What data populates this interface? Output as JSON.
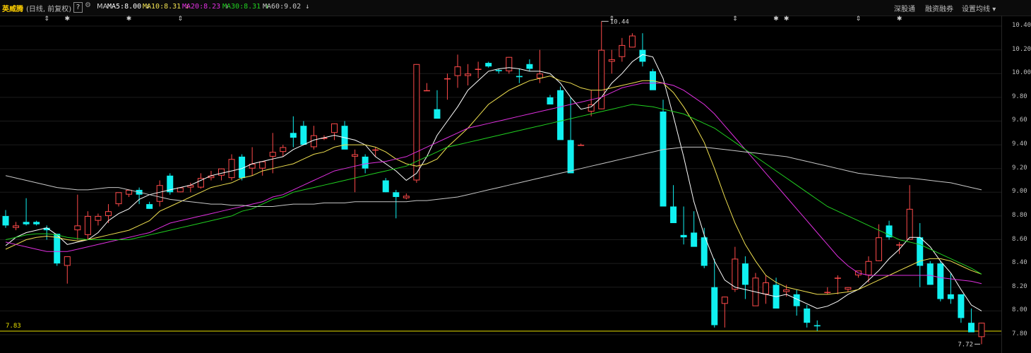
{
  "header": {
    "stock_name": "英威腾",
    "period": "(日线, 前复权)",
    "help": "?",
    "gear_icon": "gear-icon",
    "ma_title": "MA",
    "ma": [
      {
        "label": "MA5:8.00",
        "color": "#ffffff",
        "arrow": "↓"
      },
      {
        "label": "MA10:8.31",
        "color": "#f0e050",
        "arrow": "↓"
      },
      {
        "label": "MA20:8.23",
        "color": "#e030e0",
        "arrow": "↓"
      },
      {
        "label": "MA30:8.31",
        "color": "#20d020",
        "arrow": "↓"
      },
      {
        "label": "MA60:9.02",
        "color": "#c8c8c8",
        "arrow": "↓"
      }
    ],
    "links": [
      "深股通",
      "融资融券",
      "设置均线"
    ]
  },
  "chart_data": {
    "type": "candlestick",
    "ylim": [
      7.7,
      10.5
    ],
    "y_ticks": [
      7.8,
      8.0,
      8.2,
      8.4,
      8.6,
      8.8,
      9.0,
      9.2,
      9.4,
      9.6,
      9.8,
      10.0,
      10.2,
      10.4
    ],
    "y_tick_labels": [
      "7.80",
      "8.00",
      "8.20",
      "8.40",
      "8.60",
      "8.80",
      "9.00",
      "9.20",
      "9.40",
      "9.60",
      "9.80",
      "10.00",
      "10.20",
      "10.40"
    ],
    "max_label": "10.44",
    "min_label": "7.72",
    "reference_line": {
      "value": 7.83,
      "label": "7.83",
      "color": "#e8e000"
    },
    "up_color": "#ff4a4a",
    "down_color": "#10f0f0",
    "event_markers": [
      {
        "index": 4,
        "symbol": "⇕"
      },
      {
        "index": 6,
        "symbol": "✱"
      },
      {
        "index": 12,
        "symbol": "✱"
      },
      {
        "index": 17,
        "symbol": "⇕"
      },
      {
        "index": 59,
        "symbol": "⇕"
      },
      {
        "index": 71,
        "symbol": "⇕"
      },
      {
        "index": 75,
        "symbol": "✱"
      },
      {
        "index": 76,
        "symbol": "✱"
      },
      {
        "index": 83,
        "symbol": "⇕"
      },
      {
        "index": 87,
        "symbol": "✱"
      }
    ],
    "candles": [
      [
        8.8,
        8.85,
        8.7,
        8.72
      ],
      [
        8.7,
        8.75,
        8.68,
        8.72
      ],
      [
        8.75,
        8.95,
        8.72,
        8.73
      ],
      [
        8.75,
        8.76,
        8.72,
        8.73
      ],
      [
        8.7,
        8.72,
        8.6,
        8.68
      ],
      [
        8.65,
        8.65,
        8.38,
        8.4
      ],
      [
        8.38,
        8.46,
        8.23,
        8.46
      ],
      [
        8.68,
        8.98,
        8.6,
        8.72
      ],
      [
        8.64,
        8.84,
        8.6,
        8.8
      ],
      [
        8.76,
        8.82,
        8.72,
        8.8
      ],
      [
        8.8,
        8.9,
        8.74,
        8.84
      ],
      [
        8.9,
        8.98,
        8.88,
        9.0
      ],
      [
        8.98,
        9.0,
        8.96,
        9.02
      ],
      [
        9.02,
        9.04,
        8.9,
        8.98
      ],
      [
        8.9,
        8.92,
        8.86,
        8.86
      ],
      [
        8.92,
        9.1,
        8.88,
        9.06
      ],
      [
        9.14,
        9.16,
        8.98,
        9.0
      ],
      [
        9.0,
        9.04,
        9.0,
        9.04
      ],
      [
        9.04,
        9.08,
        9.0,
        9.06
      ],
      [
        9.04,
        9.16,
        9.03,
        9.12
      ],
      [
        9.12,
        9.18,
        9.1,
        9.14
      ],
      [
        9.14,
        9.2,
        9.1,
        9.2
      ],
      [
        9.12,
        9.32,
        9.1,
        9.28
      ],
      [
        9.3,
        9.32,
        9.1,
        9.12
      ],
      [
        9.2,
        9.38,
        9.14,
        9.24
      ],
      [
        9.2,
        9.26,
        9.14,
        9.26
      ],
      [
        9.3,
        9.5,
        9.16,
        9.34
      ],
      [
        9.34,
        9.4,
        9.3,
        9.38
      ],
      [
        9.5,
        9.64,
        9.38,
        9.46
      ],
      [
        9.56,
        9.6,
        9.4,
        9.4
      ],
      [
        9.38,
        9.56,
        9.36,
        9.48
      ],
      [
        9.45,
        9.48,
        9.44,
        9.46
      ],
      [
        9.5,
        9.58,
        9.44,
        9.58
      ],
      [
        9.56,
        9.6,
        9.38,
        9.36
      ],
      [
        9.3,
        9.36,
        9.0,
        9.32
      ],
      [
        9.3,
        9.32,
        9.16,
        9.2
      ],
      [
        9.36,
        9.38,
        9.3,
        9.36
      ],
      [
        9.1,
        9.12,
        9.0,
        9.0
      ],
      [
        9.0,
        9.02,
        8.78,
        8.96
      ],
      [
        8.95,
        8.99,
        8.94,
        8.97
      ],
      [
        9.1,
        10.08,
        9.08,
        10.08
      ],
      [
        9.86,
        9.92,
        9.86,
        9.86
      ],
      [
        9.7,
        9.86,
        9.62,
        9.62
      ],
      [
        9.96,
        10.0,
        9.78,
        9.96
      ],
      [
        9.98,
        10.16,
        9.88,
        10.06
      ],
      [
        9.98,
        10.08,
        9.9,
        10.0
      ],
      [
        10.04,
        10.1,
        9.96,
        10.04
      ],
      [
        10.09,
        10.1,
        10.05,
        10.06
      ],
      [
        10.03,
        10.04,
        10.0,
        10.02
      ],
      [
        10.02,
        10.14,
        10.0,
        10.14
      ],
      [
        9.98,
        10.04,
        9.92,
        9.97
      ],
      [
        10.08,
        10.12,
        10.02,
        10.04
      ],
      [
        9.96,
        10.2,
        9.92,
        10.0
      ],
      [
        9.8,
        9.82,
        9.74,
        9.74
      ],
      [
        9.86,
        9.89,
        9.56,
        9.44
      ],
      [
        9.44,
        9.8,
        9.2,
        9.16
      ],
      [
        9.4,
        9.41,
        9.4,
        9.4
      ],
      [
        9.68,
        9.86,
        9.64,
        9.74
      ],
      [
        9.7,
        10.44,
        9.7,
        10.2
      ],
      [
        10.1,
        10.2,
        10.0,
        10.12
      ],
      [
        10.14,
        10.3,
        10.1,
        10.24
      ],
      [
        10.22,
        10.34,
        10.22,
        10.32
      ],
      [
        10.2,
        10.34,
        10.06,
        10.1
      ],
      [
        10.02,
        10.04,
        9.98,
        9.86
      ],
      [
        9.68,
        9.78,
        9.64,
        8.88
      ],
      [
        8.88,
        9.06,
        8.86,
        8.74
      ],
      [
        8.64,
        8.88,
        8.56,
        8.62
      ],
      [
        8.66,
        8.84,
        8.66,
        8.54
      ],
      [
        8.62,
        8.7,
        8.36,
        8.38
      ],
      [
        8.2,
        8.44,
        7.86,
        7.88
      ],
      [
        8.06,
        8.12,
        7.86,
        8.12
      ],
      [
        8.18,
        8.54,
        8.16,
        8.44
      ],
      [
        8.4,
        8.46,
        8.1,
        8.22
      ],
      [
        8.04,
        8.32,
        8.06,
        8.28
      ],
      [
        8.14,
        8.3,
        8.06,
        8.24
      ],
      [
        8.22,
        8.28,
        8.04,
        8.02
      ],
      [
        8.16,
        8.22,
        8.12,
        8.18
      ],
      [
        8.14,
        8.18,
        7.96,
        8.04
      ],
      [
        8.02,
        8.05,
        7.86,
        7.9
      ],
      [
        7.88,
        7.92,
        7.83,
        7.87
      ],
      [
        8.16,
        8.2,
        8.14,
        8.16
      ],
      [
        8.28,
        8.3,
        8.14,
        8.28
      ],
      [
        8.18,
        8.2,
        8.16,
        8.2
      ],
      [
        8.3,
        8.32,
        8.28,
        8.34
      ],
      [
        8.3,
        8.46,
        8.24,
        8.42
      ],
      [
        8.42,
        8.73,
        8.42,
        8.62
      ],
      [
        8.72,
        8.76,
        8.6,
        8.62
      ],
      [
        8.56,
        8.58,
        8.48,
        8.56
      ],
      [
        8.6,
        9.06,
        8.6,
        8.86
      ],
      [
        8.62,
        8.74,
        8.2,
        8.38
      ],
      [
        8.4,
        8.42,
        8.22,
        8.22
      ],
      [
        8.4,
        8.42,
        8.08,
        8.1
      ],
      [
        8.14,
        8.32,
        8.06,
        8.1
      ],
      [
        8.14,
        8.14,
        7.9,
        7.94
      ],
      [
        7.9,
        8.02,
        7.86,
        7.82
      ],
      [
        7.78,
        7.9,
        7.72,
        7.9
      ]
    ],
    "ma_lines": {
      "MA5": [
        8.55,
        8.62,
        8.66,
        8.68,
        8.7,
        8.64,
        8.56,
        8.58,
        8.6,
        8.66,
        8.76,
        8.82,
        8.86,
        8.94,
        8.98,
        9.0,
        9.02,
        9.04,
        9.06,
        9.1,
        9.14,
        9.16,
        9.18,
        9.2,
        9.24,
        9.26,
        9.28,
        9.3,
        9.36,
        9.4,
        9.44,
        9.46,
        9.48,
        9.46,
        9.44,
        9.4,
        9.3,
        9.24,
        9.18,
        9.1,
        9.16,
        9.3,
        9.48,
        9.6,
        9.72,
        9.86,
        9.94,
        10.02,
        10.04,
        10.05,
        10.04,
        10.02,
        10.02,
        10.0,
        9.92,
        9.8,
        9.7,
        9.72,
        9.8,
        9.92,
        10.0,
        10.1,
        10.16,
        10.14,
        9.96,
        9.64,
        9.3,
        8.92,
        8.64,
        8.42,
        8.26,
        8.2,
        8.18,
        8.16,
        8.14,
        8.12,
        8.14,
        8.1,
        8.06,
        8.02,
        8.04,
        8.08,
        8.14,
        8.18,
        8.26,
        8.34,
        8.44,
        8.52,
        8.62,
        8.62,
        8.54,
        8.42,
        8.32,
        8.18,
        8.05,
        8.0
      ],
      "MA10": [
        8.52,
        8.56,
        8.6,
        8.62,
        8.63,
        8.62,
        8.6,
        8.59,
        8.6,
        8.62,
        8.64,
        8.66,
        8.68,
        8.72,
        8.76,
        8.84,
        8.88,
        8.92,
        8.96,
        9.0,
        9.04,
        9.06,
        9.08,
        9.12,
        9.14,
        9.18,
        9.2,
        9.22,
        9.24,
        9.28,
        9.32,
        9.34,
        9.38,
        9.4,
        9.4,
        9.4,
        9.38,
        9.34,
        9.28,
        9.24,
        9.22,
        9.24,
        9.28,
        9.38,
        9.46,
        9.54,
        9.64,
        9.74,
        9.8,
        9.86,
        9.9,
        9.94,
        9.96,
        9.98,
        9.94,
        9.92,
        9.88,
        9.86,
        9.86,
        9.88,
        9.9,
        9.92,
        9.94,
        9.94,
        9.92,
        9.84,
        9.72,
        9.58,
        9.42,
        9.2,
        8.96,
        8.74,
        8.56,
        8.42,
        8.3,
        8.24,
        8.2,
        8.18,
        8.16,
        8.14,
        8.14,
        8.15,
        8.16,
        8.18,
        8.22,
        8.26,
        8.3,
        8.34,
        8.38,
        8.42,
        8.44,
        8.44,
        8.42,
        8.38,
        8.34,
        8.31
      ],
      "MA20": [
        8.58,
        8.56,
        8.54,
        8.52,
        8.5,
        8.5,
        8.5,
        8.52,
        8.54,
        8.56,
        8.58,
        8.6,
        8.62,
        8.64,
        8.66,
        8.7,
        8.74,
        8.76,
        8.78,
        8.8,
        8.82,
        8.84,
        8.86,
        8.88,
        8.9,
        8.92,
        8.96,
        8.98,
        9.02,
        9.06,
        9.1,
        9.14,
        9.18,
        9.2,
        9.22,
        9.24,
        9.25,
        9.26,
        9.28,
        9.3,
        9.34,
        9.38,
        9.42,
        9.46,
        9.5,
        9.54,
        9.56,
        9.58,
        9.6,
        9.62,
        9.64,
        9.66,
        9.68,
        9.7,
        9.72,
        9.74,
        9.76,
        9.78,
        9.8,
        9.84,
        9.88,
        9.9,
        9.92,
        9.92,
        9.92,
        9.9,
        9.86,
        9.8,
        9.74,
        9.66,
        9.56,
        9.46,
        9.36,
        9.26,
        9.16,
        9.06,
        8.96,
        8.86,
        8.76,
        8.66,
        8.56,
        8.46,
        8.38,
        8.32,
        8.3,
        8.3,
        8.3,
        8.3,
        8.3,
        8.3,
        8.3,
        8.28,
        8.27,
        8.26,
        8.25,
        8.23
      ],
      "MA30": [
        8.6,
        8.62,
        8.64,
        8.65,
        8.65,
        8.64,
        8.62,
        8.61,
        8.6,
        8.6,
        8.6,
        8.6,
        8.6,
        8.62,
        8.64,
        8.66,
        8.68,
        8.7,
        8.72,
        8.74,
        8.76,
        8.78,
        8.8,
        8.84,
        8.86,
        8.9,
        8.94,
        8.96,
        9.0,
        9.02,
        9.04,
        9.06,
        9.08,
        9.1,
        9.12,
        9.14,
        9.16,
        9.18,
        9.2,
        9.22,
        9.26,
        9.3,
        9.34,
        9.38,
        9.4,
        9.42,
        9.44,
        9.46,
        9.48,
        9.5,
        9.52,
        9.54,
        9.56,
        9.58,
        9.6,
        9.62,
        9.64,
        9.66,
        9.68,
        9.7,
        9.72,
        9.74,
        9.73,
        9.72,
        9.7,
        9.68,
        9.66,
        9.62,
        9.58,
        9.54,
        9.48,
        9.42,
        9.36,
        9.3,
        9.24,
        9.18,
        9.12,
        9.06,
        9.0,
        8.94,
        8.88,
        8.84,
        8.8,
        8.76,
        8.72,
        8.68,
        8.64,
        8.6,
        8.58,
        8.56,
        8.52,
        8.48,
        8.44,
        8.4,
        8.36,
        8.31
      ],
      "MA60": [
        9.14,
        9.12,
        9.1,
        9.08,
        9.06,
        9.04,
        9.03,
        9.02,
        9.02,
        9.03,
        9.04,
        9.04,
        9.02,
        9.0,
        8.98,
        8.96,
        8.94,
        8.93,
        8.92,
        8.91,
        8.9,
        8.9,
        8.89,
        8.89,
        8.88,
        8.88,
        8.88,
        8.89,
        8.9,
        8.9,
        8.9,
        8.91,
        8.91,
        8.91,
        8.92,
        8.92,
        8.92,
        8.92,
        8.92,
        8.92,
        8.93,
        8.93,
        8.94,
        8.95,
        8.96,
        8.98,
        9.0,
        9.02,
        9.04,
        9.06,
        9.08,
        9.1,
        9.12,
        9.14,
        9.16,
        9.18,
        9.2,
        9.22,
        9.24,
        9.26,
        9.28,
        9.3,
        9.32,
        9.34,
        9.36,
        9.37,
        9.38,
        9.38,
        9.38,
        9.37,
        9.36,
        9.35,
        9.34,
        9.33,
        9.32,
        9.31,
        9.3,
        9.28,
        9.26,
        9.24,
        9.22,
        9.2,
        9.18,
        9.16,
        9.15,
        9.14,
        9.13,
        9.12,
        9.12,
        9.11,
        9.1,
        9.09,
        9.08,
        9.06,
        9.04,
        9.02
      ]
    }
  }
}
